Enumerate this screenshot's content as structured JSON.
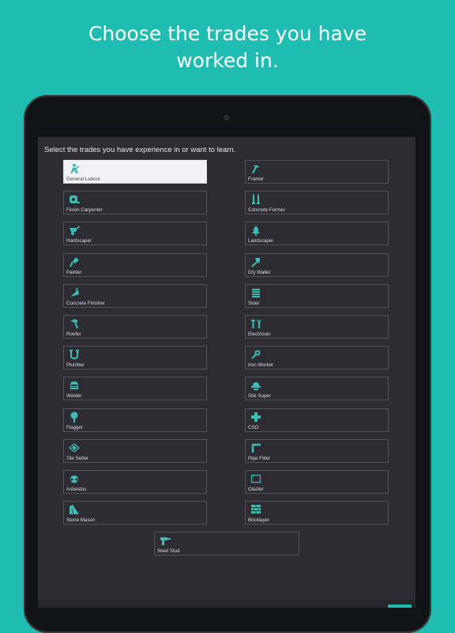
{
  "headline_line1": "Choose the trades you have",
  "headline_line2": "worked in.",
  "instruction": "Select the trades you have experience in or want to learn.",
  "colors": {
    "accent": "#1fbcb1",
    "screen": "#2d2c33",
    "selected": "#f2f2f4"
  },
  "trades": [
    {
      "label": "General Labour",
      "icon": "labourer-icon",
      "selected": true
    },
    {
      "label": "Framer",
      "icon": "hammer-icon",
      "selected": false
    },
    {
      "label": "Finish Carpenter",
      "icon": "tape-measure-icon",
      "selected": false
    },
    {
      "label": "Concrete Former",
      "icon": "clamps-icon",
      "selected": false
    },
    {
      "label": "Hardscaper",
      "icon": "wheelbarrow-icon",
      "selected": false
    },
    {
      "label": "Landscaper",
      "icon": "tree-icon",
      "selected": false
    },
    {
      "label": "Painter",
      "icon": "paintbrush-icon",
      "selected": false
    },
    {
      "label": "Dry Waller",
      "icon": "drywall-knife-icon",
      "selected": false
    },
    {
      "label": "Concrete Finisher",
      "icon": "trowel-icon",
      "selected": false
    },
    {
      "label": "Sider",
      "icon": "siding-icon",
      "selected": false
    },
    {
      "label": "Roofer",
      "icon": "roof-hammer-icon",
      "selected": false
    },
    {
      "label": "Electrician",
      "icon": "pliers-icon",
      "selected": false
    },
    {
      "label": "Plumber",
      "icon": "pipe-icon",
      "selected": false
    },
    {
      "label": "Iron Worker",
      "icon": "wrench-icon",
      "selected": false
    },
    {
      "label": "Welder",
      "icon": "welding-mask-icon",
      "selected": false
    },
    {
      "label": "Site Super",
      "icon": "hard-hat-icon",
      "selected": false
    },
    {
      "label": "Flagger",
      "icon": "stop-sign-icon",
      "selected": false
    },
    {
      "label": "CSO",
      "icon": "safety-cross-icon",
      "selected": false
    },
    {
      "label": "Tile Setter",
      "icon": "tile-icon",
      "selected": false
    },
    {
      "label": "Pipe Fitter",
      "icon": "pipe-elbow-icon",
      "selected": false
    },
    {
      "label": "Asbestos",
      "icon": "respirator-icon",
      "selected": false
    },
    {
      "label": "Glazier",
      "icon": "glass-pane-icon",
      "selected": false
    },
    {
      "label": "Stone Mason",
      "icon": "stone-icon",
      "selected": false
    },
    {
      "label": "Bricklayer",
      "icon": "brick-icon",
      "selected": false
    },
    {
      "label": "Steel Stud",
      "icon": "drill-icon",
      "selected": false
    }
  ]
}
